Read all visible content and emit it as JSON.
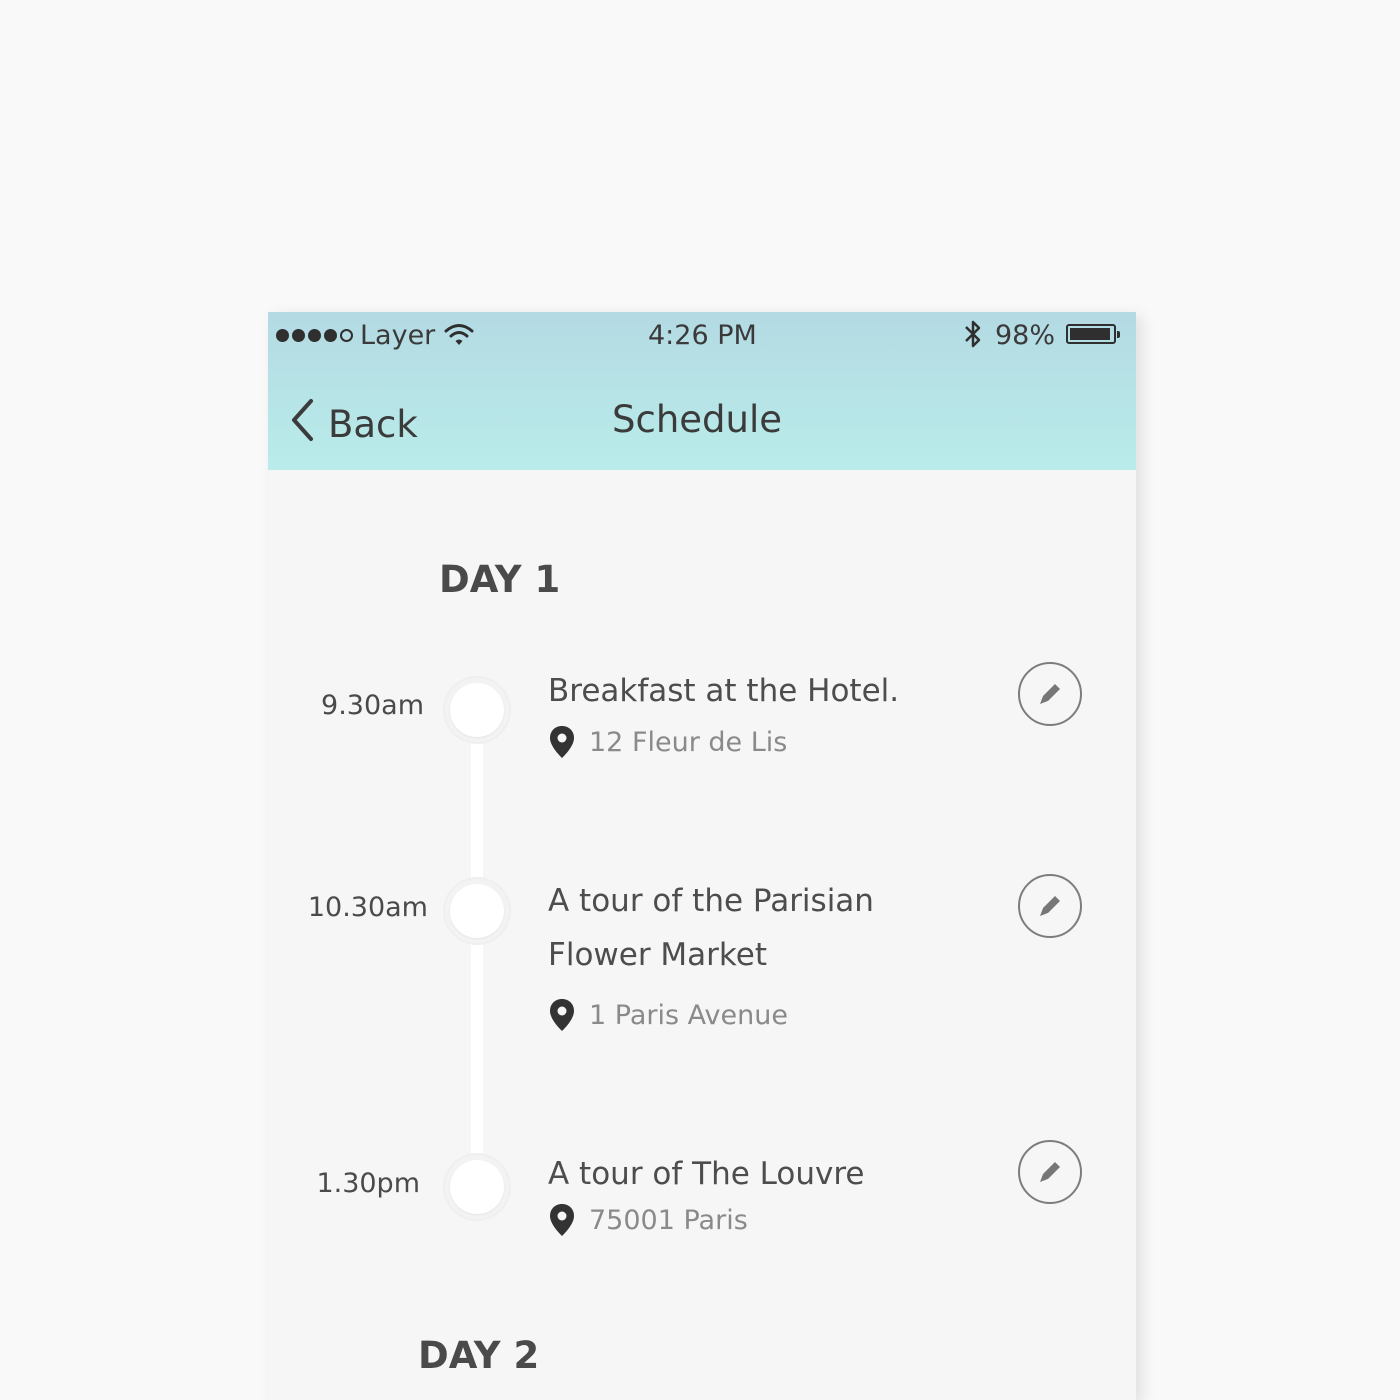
{
  "status_bar": {
    "carrier": "Layer",
    "time": "4:26 PM",
    "battery": "98%",
    "battery_level": 0.98,
    "signal_bars_filled": 4,
    "signal_bars_total": 5
  },
  "nav": {
    "back_label": "Back",
    "title": "Schedule"
  },
  "days": [
    {
      "label": "DAY 1",
      "events": [
        {
          "time": "9.30am",
          "title": "Breakfast at the Hotel.",
          "location": "12 Fleur de Lis"
        },
        {
          "time": "10.30am",
          "title_line1": "A tour of the Parisian",
          "title_line2": "Flower Market",
          "location": "1 Paris Avenue"
        },
        {
          "time": "1.30pm",
          "title": "A tour of The Louvre",
          "location": "75001 Paris"
        }
      ]
    },
    {
      "label": "DAY 2",
      "events": []
    }
  ],
  "icons": {
    "back": "chevron-left-icon",
    "wifi": "wifi-icon",
    "bluetooth": "bluetooth-icon",
    "location": "location-pin-icon",
    "edit": "pencil-icon"
  },
  "colors": {
    "header_top": "#b4dae3",
    "header_bottom": "#b9ecea",
    "background": "#f6f6f6",
    "text": "#4a4a4a"
  }
}
